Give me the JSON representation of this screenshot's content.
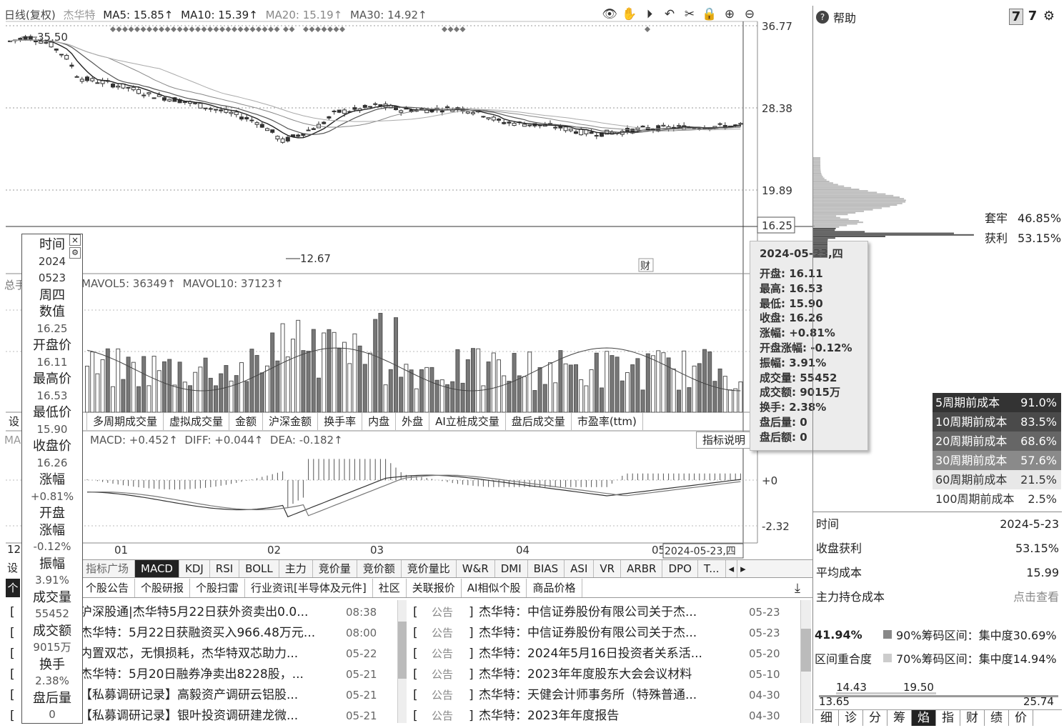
{
  "header": {
    "period": "日线(复权)",
    "stock": "杰华特",
    "ma5": "MA5: 15.85↑",
    "ma10": "MA10: 15.39↑",
    "ma20": "MA20: 15.19↑",
    "ma30": "MA30: 14.92↑"
  },
  "toolbar_icons": [
    "eye-icon",
    "hand-icon",
    "play-icon",
    "undo-icon",
    "scissors-icon",
    "lock-icon",
    "zoom-in-icon",
    "zoom-out-icon"
  ],
  "price_axis": [
    "36.77",
    "28.38",
    "19.89",
    "16.25"
  ],
  "price_annotations": {
    "high": "35.50",
    "low": "12.67",
    "cai": "财"
  },
  "volume_header": "MAVOL5: 36349↑  MAVOL10: 37123↑",
  "volume_label_left": "总手",
  "indicator_tabs": [
    "多周期成交量",
    "虚拟成交量",
    "金额",
    "沪深金额",
    "换手率",
    "内盘",
    "外盘",
    "AI立桩成交量",
    "盘后成交量",
    "市盈率(ttm)"
  ],
  "macd_header": "MACD: +0.452↑  DIFF: +0.044↑  DEA: -0.182↑",
  "macd_axis": [
    "+0",
    "-2.32"
  ],
  "macd_left_label": "MA",
  "indicator_help": "指标说明",
  "date_axis": [
    "01",
    "02",
    "03",
    "04",
    "05"
  ],
  "cursor_date": "2024-05-23,四",
  "bottom_tabs": [
    "指标广场",
    "MACD",
    "KDJ",
    "RSI",
    "BOLL",
    "主力",
    "竞价量",
    "竞价额",
    "竞价量比",
    "W&R",
    "DMI",
    "BIAS",
    "ASI",
    "VR",
    "ARBR",
    "DPO",
    "T..."
  ],
  "news_tabs": [
    "个股公告",
    "个股研报",
    "个股扫雷",
    "行业资讯[半导体及元件]",
    "社区",
    "关联报价",
    "AI相似个股",
    "商品价格"
  ],
  "news_left": [
    {
      "text": "沪深股通|杰华特5月22日获外资卖出0.0...",
      "time": "08:38"
    },
    {
      "text": "杰华特：5月22日获融资买入966.48万元...",
      "time": "08:00"
    },
    {
      "text": "内置双芯，无惧损耗，杰华特双芯助力...",
      "time": "05-22"
    },
    {
      "text": "杰华特：5月20日融券净卖出8228股，...",
      "time": "05-21"
    },
    {
      "text": "【私募调研记录】高毅资产调研云铝股...",
      "time": "05-21"
    },
    {
      "text": "【私募调研记录】银叶投资调研建龙微...",
      "time": "05-21"
    }
  ],
  "news_right": [
    {
      "tag": "公告",
      "text": "杰华特：中信证券股份有限公司关于杰...",
      "time": "05-23"
    },
    {
      "tag": "公告",
      "text": "杰华特：中信证券股份有限公司关于杰...",
      "time": "05-23"
    },
    {
      "tag": "公告",
      "text": "杰华特：2024年5月16日投资者关系活...",
      "time": "05-20"
    },
    {
      "tag": "公告",
      "text": "杰华特：2023年年度股东大会会议材料",
      "time": "05-10"
    },
    {
      "tag": "公告",
      "text": "杰华特：天健会计师事务所（特殊普通...",
      "time": "04-30"
    },
    {
      "tag": "公告",
      "text": "杰华特：2023年年度报告",
      "time": "04-30"
    }
  ],
  "left_panel": {
    "items": [
      {
        "label": "时间",
        "value": "2024"
      },
      {
        "label": "",
        "value": "0523"
      },
      {
        "label": "周四",
        "value": ""
      },
      {
        "label": "数值",
        "value": "16.25"
      },
      {
        "label": "开盘价",
        "value": "16.11"
      },
      {
        "label": "最高价",
        "value": "16.53"
      },
      {
        "label": "最低价",
        "value": "15.90"
      },
      {
        "label": "收盘价",
        "value": "16.26"
      },
      {
        "label": "涨幅",
        "value": "+0.81%"
      },
      {
        "label": "开盘涨幅",
        "value": "-0.12%"
      },
      {
        "label": "振幅",
        "value": "3.91%"
      },
      {
        "label": "成交量",
        "value": "55452"
      },
      {
        "label": "成交额",
        "value": "9015万"
      },
      {
        "label": "换手",
        "value": "2.38%"
      },
      {
        "label": "盘后量",
        "value": "0"
      }
    ]
  },
  "left_edge_labels": [
    "设",
    "12",
    "设",
    "个"
  ],
  "tooltip": {
    "date": "2024-05-23,四",
    "rows": [
      "开盘: 16.11",
      "最高: 16.53",
      "最低: 15.90",
      "收盘: 16.26",
      "涨幅: +0.81%",
      "开盘涨幅: -0.12%",
      "振幅: 3.91%",
      "成交量: 55452",
      "成交额: 9015万",
      "换手: 2.38%",
      "盘后量: 0",
      "盘后额: 0"
    ]
  },
  "right_panel": {
    "help": "帮助",
    "tao_label": "套牢",
    "tao_value": "46.85%",
    "huo_label": "获利",
    "huo_value": "53.15%",
    "period_costs": [
      {
        "label": "5周期前成本",
        "value": "91.0%"
      },
      {
        "label": "10周期前成本",
        "value": "83.5%"
      },
      {
        "label": "20周期前成本",
        "value": "68.6%"
      },
      {
        "label": "30周期前成本",
        "value": "57.6%"
      },
      {
        "label": "60周期前成本",
        "value": "21.5%"
      },
      {
        "label": "100周期前成本",
        "value": "2.5%"
      }
    ],
    "info": [
      {
        "label": "时间",
        "value": "2024-5-23"
      },
      {
        "label": "收盘获利",
        "value": "53.15%"
      },
      {
        "label": "平均成本",
        "value": "15.99"
      },
      {
        "label": "主力持仓成本",
        "value": "点击查看"
      }
    ],
    "conc_pct": "41.94%",
    "conc90": "90%筹码区间：集中度30.69%",
    "overlap_label": "区间重合度",
    "conc70": "70%筹码区间：集中度14.94%",
    "range_top": [
      "14.43",
      "19.50"
    ],
    "range_bottom": [
      "13.65",
      "25.74"
    ],
    "bottom_tabs": [
      "细",
      "诊",
      "分",
      "筹",
      "焰",
      "指",
      "财",
      "绩",
      "价"
    ]
  }
}
